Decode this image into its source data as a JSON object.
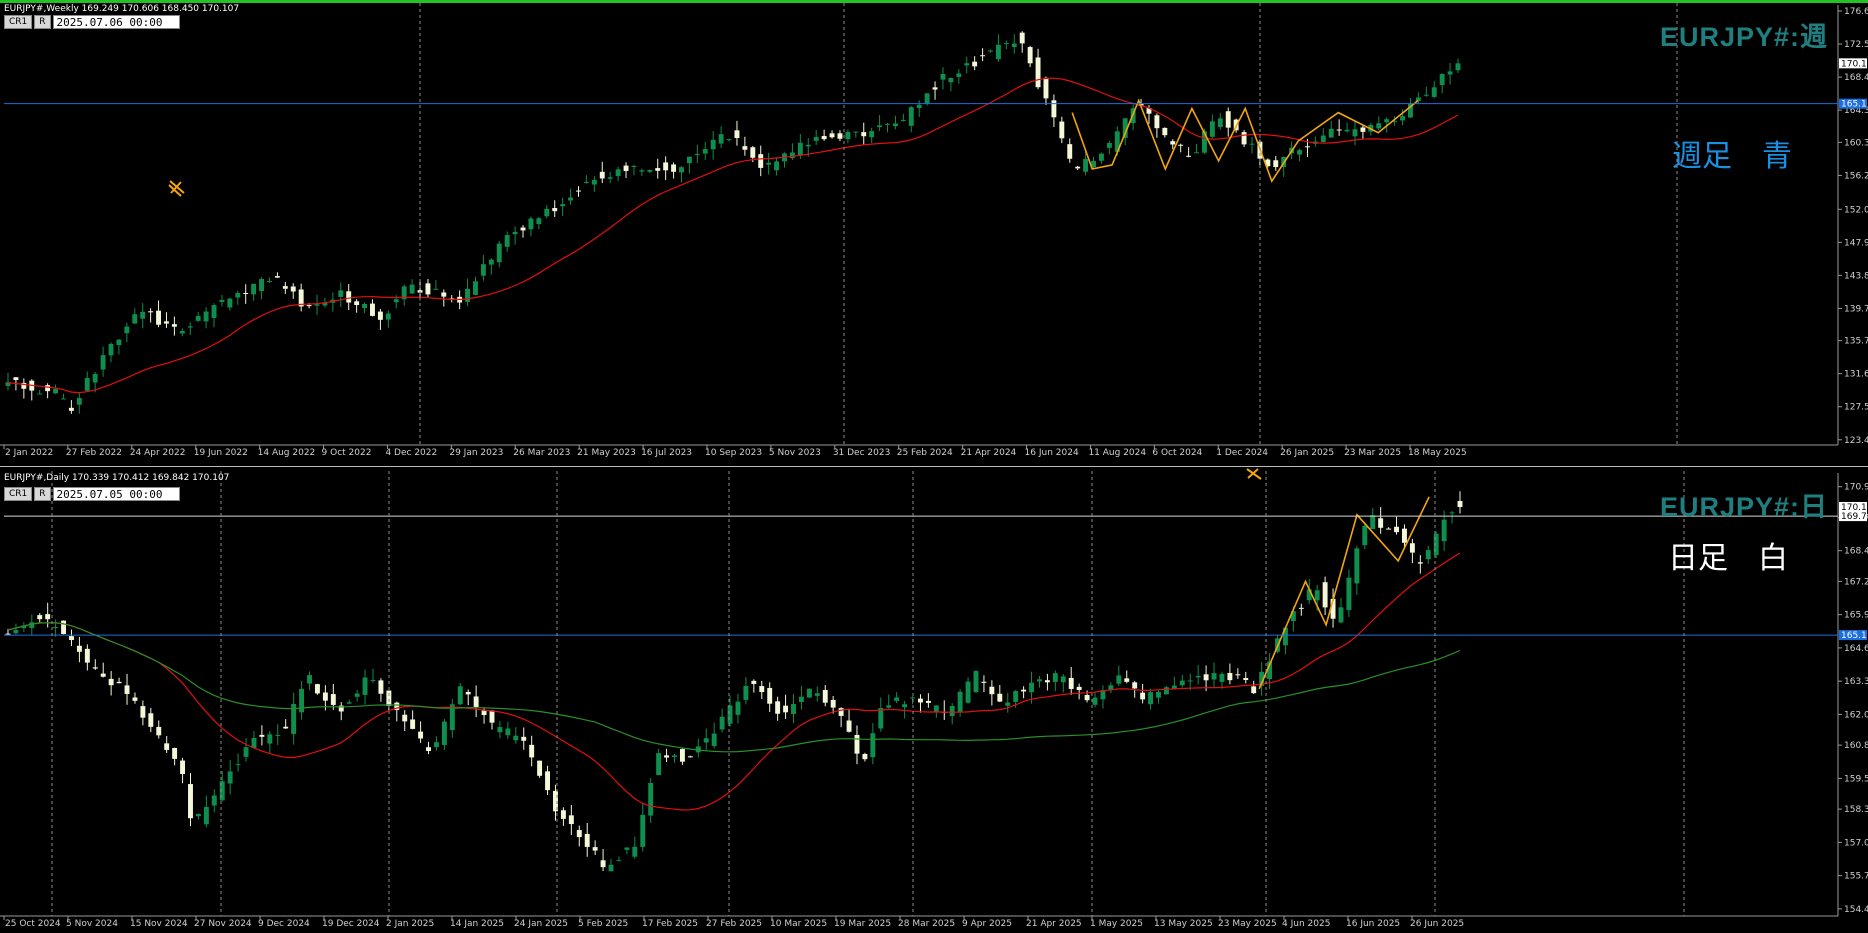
{
  "colors": {
    "background": "#000000",
    "bull": "#0e8f4d",
    "bear": "#f5f8d8",
    "ma_red": "#e01010",
    "ma_green": "#2a8f2a",
    "zigzag": "#f2a50f",
    "hline": "#1b6fe0",
    "grid": "#8c8c8c",
    "axis": "#9a9a9a",
    "watermark": "#1f7f80",
    "note_blue": "#1b8fe0",
    "note_white": "#ffffff"
  },
  "icons": {
    "drawing_tool": "pencil-ruler-icon"
  },
  "weekly": {
    "header": "EURJPY#,Weekly  169.249 170.606 168.450 170.107",
    "cr_label": "CR1",
    "r_label": "R",
    "time": "2025.07.06 00:00",
    "watermark": "EURJPY#:週",
    "note": "週足　青",
    "chart_data": {
      "type": "candlestick",
      "timeframe": "Weekly",
      "ohlc": {
        "open": 169.249,
        "high": 170.606,
        "low": 168.45,
        "close": 170.107
      },
      "ylim": [
        123.0,
        176.6
      ],
      "y_ticks": [
        "176.6",
        "172.5",
        "168.4",
        "164.3",
        "160.3",
        "156.2",
        "152.0",
        "147.9",
        "143.8",
        "139.7",
        "135.7",
        "131.6",
        "127.5",
        "123.4"
      ],
      "y_tick_values": [
        176.6,
        172.5,
        168.4,
        164.3,
        160.3,
        156.2,
        152.0,
        147.9,
        143.8,
        139.7,
        135.7,
        131.6,
        127.5,
        123.4
      ],
      "current_price_label": "170.1",
      "current_price": 170.107,
      "hline_label": "165.1",
      "hline_price": 165.1,
      "x_labels": [
        "2 Jan 2022",
        "27 Feb 2022",
        "24 Apr 2022",
        "19 Jun 2022",
        "14 Aug 2022",
        "9 Oct 2022",
        "4 Dec 2022",
        "29 Jan 2023",
        "26 Mar 2023",
        "21 May 2023",
        "16 Jul 2023",
        "10 Sep 2023",
        "5 Nov 2023",
        "31 Dec 2023",
        "25 Feb 2024",
        "21 Apr 2024",
        "16 Jun 2024",
        "11 Aug 2024",
        "6 Oct 2024",
        "1 Dec 2024",
        "26 Jan 2025",
        "23 Mar 2025",
        "18 May 2025"
      ],
      "bars": 184,
      "close_anchors": [
        [
          0,
          130.5
        ],
        [
          8,
          129.0
        ],
        [
          9,
          126.2
        ],
        [
          14,
          133.5
        ],
        [
          20,
          139.5
        ],
        [
          26,
          136.8
        ],
        [
          34,
          141.5
        ],
        [
          40,
          143.5
        ],
        [
          45,
          139.8
        ],
        [
          50,
          141.5
        ],
        [
          56,
          138.5
        ],
        [
          60,
          142.5
        ],
        [
          68,
          141.0
        ],
        [
          75,
          148.5
        ],
        [
          80,
          151.0
        ],
        [
          88,
          156.0
        ],
        [
          96,
          157.5
        ],
        [
          100,
          157.0
        ],
        [
          108,
          161.5
        ],
        [
          114,
          157.0
        ],
        [
          120,
          160.5
        ],
        [
          128,
          161.5
        ],
        [
          134,
          162.5
        ],
        [
          140,
          168.0
        ],
        [
          148,
          171.5
        ],
        [
          152,
          173.5
        ],
        [
          155,
          167.5
        ],
        [
          160,
          157.0
        ],
        [
          166,
          160.0
        ],
        [
          170,
          165.5
        ],
        [
          174,
          160.5
        ],
        [
          178,
          158.5
        ],
        [
          182,
          164.0
        ],
        [
          186,
          160.5
        ],
        [
          190,
          157.5
        ],
        [
          196,
          160.5
        ],
        [
          200,
          162.0
        ],
        [
          204,
          161.5
        ],
        [
          210,
          164.0
        ],
        [
          216,
          169.0
        ],
        [
          218,
          170.1
        ]
      ],
      "vertical_separator_label_index": [
        6,
        12,
        18
      ],
      "ma_period": 21,
      "zigzag_points": [
        [
          160,
          164.0
        ],
        [
          163,
          157.0
        ],
        [
          166,
          157.5
        ],
        [
          170,
          165.5
        ],
        [
          174,
          157.0
        ],
        [
          178,
          164.5
        ],
        [
          182,
          158.0
        ],
        [
          186,
          164.5
        ],
        [
          190,
          155.5
        ],
        [
          194,
          160.5
        ],
        [
          200,
          164.0
        ],
        [
          206,
          161.5
        ],
        [
          212,
          165.5
        ]
      ]
    }
  },
  "daily": {
    "header": "EURJPY#,Daily  170.339 170.412 169.842 170.107",
    "cr_label": "CR1",
    "r_label": "R",
    "time": "2025.07.05 00:00",
    "watermark": "EURJPY#:日",
    "note": "日足　白",
    "chart_data": {
      "type": "candlestick",
      "timeframe": "Daily",
      "ohlc": {
        "open": 170.339,
        "high": 170.412,
        "low": 169.842,
        "close": 170.107
      },
      "ylim": [
        154.2,
        171.2
      ],
      "y_ticks": [
        "170.9",
        "169.7",
        "168.4",
        "167.2",
        "165.9",
        "164.6",
        "163.3",
        "162.0",
        "160.8",
        "159.5",
        "158.3",
        "157.0",
        "155.7",
        "154.4"
      ],
      "y_tick_values": [
        170.9,
        169.7,
        168.4,
        167.2,
        165.9,
        164.6,
        163.3,
        162.0,
        160.8,
        159.5,
        158.3,
        157.0,
        155.7,
        154.4
      ],
      "current_price_label": "170.1",
      "current_price": 170.107,
      "level_label": "169.7",
      "level_price": 169.75,
      "hline_label": "165.1",
      "hline_price": 165.1,
      "x_labels": [
        "25 Oct 2024",
        "5 Nov 2024",
        "15 Nov 2024",
        "27 Nov 2024",
        "9 Dec 2024",
        "19 Dec 2024",
        "2 Jan 2025",
        "14 Jan 2025",
        "24 Jan 2025",
        "5 Feb 2025",
        "17 Feb 2025",
        "27 Feb 2025",
        "10 Mar 2025",
        "19 Mar 2025",
        "28 Mar 2025",
        "9 Apr 2025",
        "21 Apr 2025",
        "1 May 2025",
        "13 May 2025",
        "23 May 2025",
        "4 Jun 2025",
        "16 Jun 2025",
        "26 Jun 2025"
      ],
      "bars": 184,
      "close_anchors": [
        [
          0,
          165.3
        ],
        [
          5,
          165.8
        ],
        [
          10,
          165.5
        ],
        [
          16,
          163.8
        ],
        [
          22,
          163.0
        ],
        [
          28,
          161.5
        ],
        [
          34,
          159.5
        ],
        [
          36,
          157.6
        ],
        [
          42,
          159.5
        ],
        [
          48,
          161.0
        ],
        [
          54,
          161.5
        ],
        [
          58,
          163.5
        ],
        [
          64,
          162.0
        ],
        [
          70,
          163.5
        ],
        [
          76,
          162.0
        ],
        [
          82,
          160.5
        ],
        [
          88,
          163.0
        ],
        [
          94,
          161.5
        ],
        [
          100,
          161.0
        ],
        [
          106,
          158.5
        ],
        [
          112,
          157.0
        ],
        [
          116,
          156.0
        ],
        [
          122,
          157.0
        ],
        [
          126,
          160.5
        ],
        [
          132,
          160.3
        ],
        [
          138,
          161.5
        ],
        [
          144,
          163.3
        ],
        [
          150,
          162.0
        ],
        [
          156,
          163.0
        ],
        [
          160,
          162.5
        ],
        [
          166,
          160.0
        ],
        [
          170,
          162.5
        ],
        [
          176,
          162.5
        ],
        [
          182,
          162.0
        ],
        [
          188,
          163.5
        ],
        [
          192,
          162.3
        ],
        [
          198,
          163.0
        ],
        [
          204,
          163.5
        ],
        [
          210,
          162.5
        ],
        [
          216,
          163.5
        ],
        [
          220,
          162.5
        ],
        [
          226,
          163.0
        ],
        [
          232,
          163.5
        ],
        [
          238,
          163.5
        ],
        [
          242,
          163.0
        ],
        [
          248,
          165.5
        ],
        [
          254,
          167.0
        ],
        [
          258,
          165.5
        ],
        [
          264,
          169.8
        ],
        [
          270,
          169.0
        ],
        [
          274,
          167.8
        ],
        [
          280,
          170.0
        ],
        [
          282,
          170.1
        ]
      ],
      "ma_red_period": 20,
      "ma_green_period": 75,
      "zigzag_points": [
        [
          243,
          163.0
        ],
        [
          252,
          167.2
        ],
        [
          256,
          165.5
        ],
        [
          262,
          169.8
        ],
        [
          270,
          168.0
        ],
        [
          276,
          170.5
        ]
      ]
    }
  }
}
